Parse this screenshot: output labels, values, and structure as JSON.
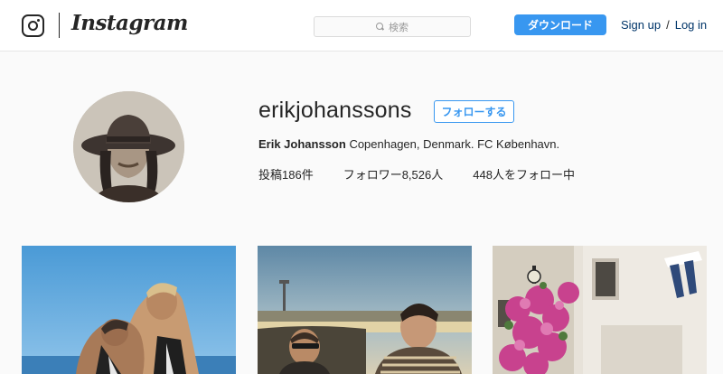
{
  "header": {
    "wordmark": "Instagram",
    "search_placeholder": "検索",
    "download_label": "ダウンロード",
    "signup_label": "Sign up",
    "separator": "/",
    "login_label": "Log in"
  },
  "profile": {
    "username": "erikjohanssons",
    "follow_label": "フォローする",
    "full_name": "Erik Johansson",
    "bio": "Copenhagen, Denmark. FC København.",
    "stats": {
      "posts": "投稿186件",
      "followers": "フォロワー8,526人",
      "following": "448人をフォロー中"
    }
  },
  "colors": {
    "accent": "#3897f0",
    "link": "#003569",
    "background": "#fafafa"
  },
  "icons": [
    "instagram-camera-icon",
    "search-icon"
  ]
}
